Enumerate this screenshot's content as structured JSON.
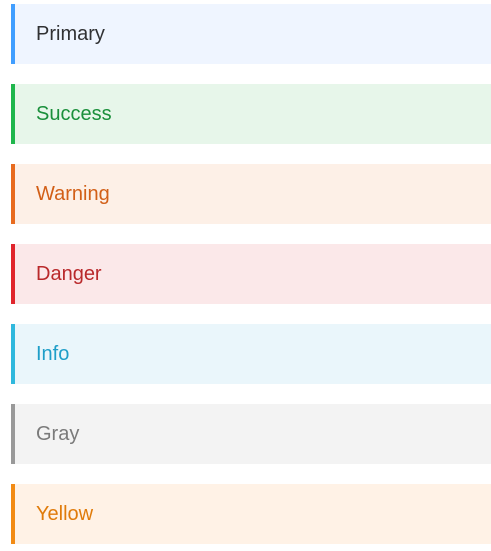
{
  "alerts": [
    {
      "key": "primary",
      "label": "Primary",
      "border_color": "#409eff",
      "background": "#eff5ff",
      "text_color": "#303133"
    },
    {
      "key": "success",
      "label": "Success",
      "border_color": "#1fb64c",
      "background": "#e7f6ea",
      "text_color": "#1a8f3b"
    },
    {
      "key": "warning",
      "label": "Warning",
      "border_color": "#e86b1f",
      "background": "#fdf0e7",
      "text_color": "#d25f17"
    },
    {
      "key": "danger",
      "label": "Danger",
      "border_color": "#e0252c",
      "background": "#fbe8e9",
      "text_color": "#b9292b"
    },
    {
      "key": "info",
      "label": "Info",
      "border_color": "#2fb8dd",
      "background": "#eaf6fb",
      "text_color": "#1e9ec8"
    },
    {
      "key": "gray",
      "label": "Gray",
      "border_color": "#999999",
      "background": "#f3f3f3",
      "text_color": "#7a7a7a"
    },
    {
      "key": "yellow",
      "label": "Yellow",
      "border_color": "#f28b14",
      "background": "#fff2e6",
      "text_color": "#e07b0a"
    }
  ]
}
